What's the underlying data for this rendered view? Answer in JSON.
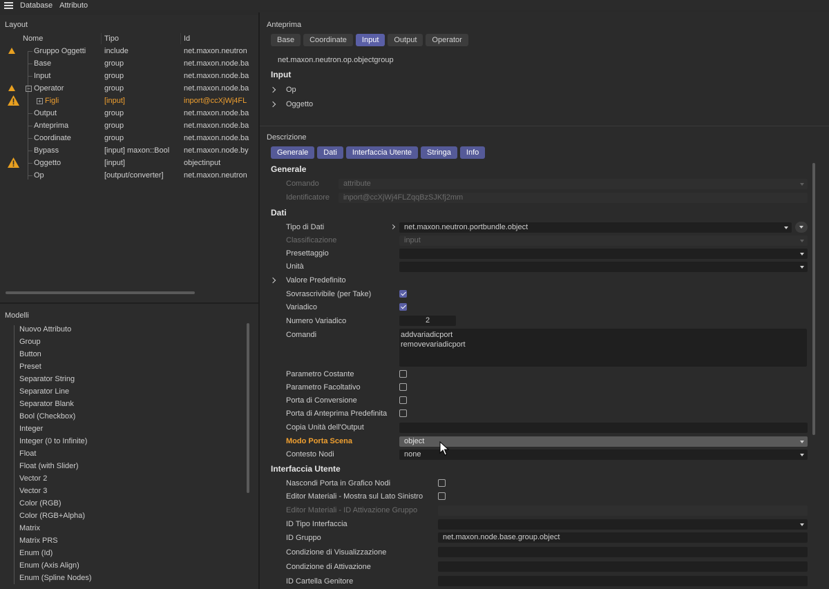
{
  "menu": {
    "items": [
      "Database",
      "Attributo"
    ]
  },
  "layout": {
    "title": "Layout",
    "columns": [
      "Nome",
      "Tipo",
      "Id"
    ],
    "rows": [
      {
        "name": "Gruppo Oggetti",
        "type": "include",
        "id": "net.maxon.neutron",
        "warn": "small"
      },
      {
        "name": "Base",
        "type": "group",
        "id": "net.maxon.node.ba"
      },
      {
        "name": "Input",
        "type": "group",
        "id": "net.maxon.node.ba"
      },
      {
        "name": "Operator",
        "type": "group",
        "id": "net.maxon.node.ba",
        "warn": "small"
      },
      {
        "name": "Figli",
        "type": "[input]",
        "id": "inport@ccXjWj4FL",
        "warn": "large",
        "orange": true
      },
      {
        "name": "Output",
        "type": "group",
        "id": "net.maxon.node.ba"
      },
      {
        "name": "Anteprima",
        "type": "group",
        "id": "net.maxon.node.ba"
      },
      {
        "name": "Coordinate",
        "type": "group",
        "id": "net.maxon.node.ba"
      },
      {
        "name": "Bypass",
        "type": "[input] maxon::Bool",
        "id": "net.maxon.node.by"
      },
      {
        "name": "Oggetto",
        "type": "[input]",
        "id": "objectinput",
        "warn": "large"
      },
      {
        "name": "Op",
        "type": "[output/converter]",
        "id": "net.maxon.neutron"
      }
    ]
  },
  "models": {
    "title": "Modelli",
    "items": [
      "Nuovo Attributo",
      "Group",
      "Button",
      "Preset",
      "Separator String",
      "Separator Line",
      "Separator Blank",
      "Bool (Checkbox)",
      "Integer",
      "Integer (0 to Infinite)",
      "Float",
      "Float (with Slider)",
      "Vector 2",
      "Vector 3",
      "Color (RGB)",
      "Color (RGB+Alpha)",
      "Matrix",
      "Matrix PRS",
      "Enum (Id)",
      "Enum (Axis Align)",
      "Enum (Spline Nodes)"
    ]
  },
  "preview": {
    "title": "Anteprima",
    "tabs": [
      "Base",
      "Coordinate",
      "Input",
      "Output",
      "Operator"
    ],
    "active_tab": "Input",
    "path": "net.maxon.neutron.op.objectgroup",
    "section": "Input",
    "items": [
      "Op",
      "Oggetto"
    ]
  },
  "description": {
    "title": "Descrizione",
    "tabs": [
      "Generale",
      "Dati",
      "Interfaccia Utente",
      "Stringa",
      "Info"
    ],
    "generale": {
      "header": "Generale",
      "comando_label": "Comando",
      "comando_value": "attribute",
      "identificatore_label": "Identificatore",
      "identificatore_value": "inport@ccXjWj4FLZqqBzSJKfj2mm"
    },
    "dati": {
      "header": "Dati",
      "tipo_label": "Tipo di Dati",
      "tipo_value": "net.maxon.neutron.portbundle.object",
      "classificazione_label": "Classificazione",
      "classificazione_value": "input",
      "presettaggio_label": "Presettaggio",
      "unita_label": "Unità",
      "valore_label": "Valore Predefinito",
      "sovrascrivibile_label": "Sovrascrivibile (per Take)",
      "variadico_label": "Variadico",
      "numero_label": "Numero Variadico",
      "numero_value": "2",
      "comandi_label": "Comandi",
      "comandi_lines": [
        "addvariadicport",
        "removevariadicport"
      ],
      "costante_label": "Parametro Costante",
      "facoltativo_label": "Parametro Facoltativo",
      "conversione_label": "Porta di Conversione",
      "anteprima_label": "Porta di Anteprima Predefinita",
      "copia_label": "Copia Unità dell'Output",
      "modo_label": "Modo Porta Scena",
      "modo_value": "object",
      "contesto_label": "Contesto Nodi",
      "contesto_value": "none"
    },
    "ui": {
      "header": "Interfaccia Utente",
      "nascondi_label": "Nascondi Porta in Grafico Nodi",
      "editor_sx_label": "Editor Materiali - Mostra sul Lato Sinistro",
      "editor_id_label": "Editor Materiali - ID Attivazione Gruppo",
      "tipo_interfaccia_label": "ID Tipo Interfaccia",
      "gruppo_label": "ID Gruppo",
      "gruppo_value": "net.maxon.node.base.group.object",
      "visualizzazione_label": "Condizione di Visualizzazione",
      "attivazione_label": "Condizione di Attivazione",
      "cartella_label": "ID Cartella Genitore"
    }
  },
  "colors": {
    "accent": "#5a5fa6",
    "warning": "#f0a030",
    "background": "#2b2b2b"
  }
}
